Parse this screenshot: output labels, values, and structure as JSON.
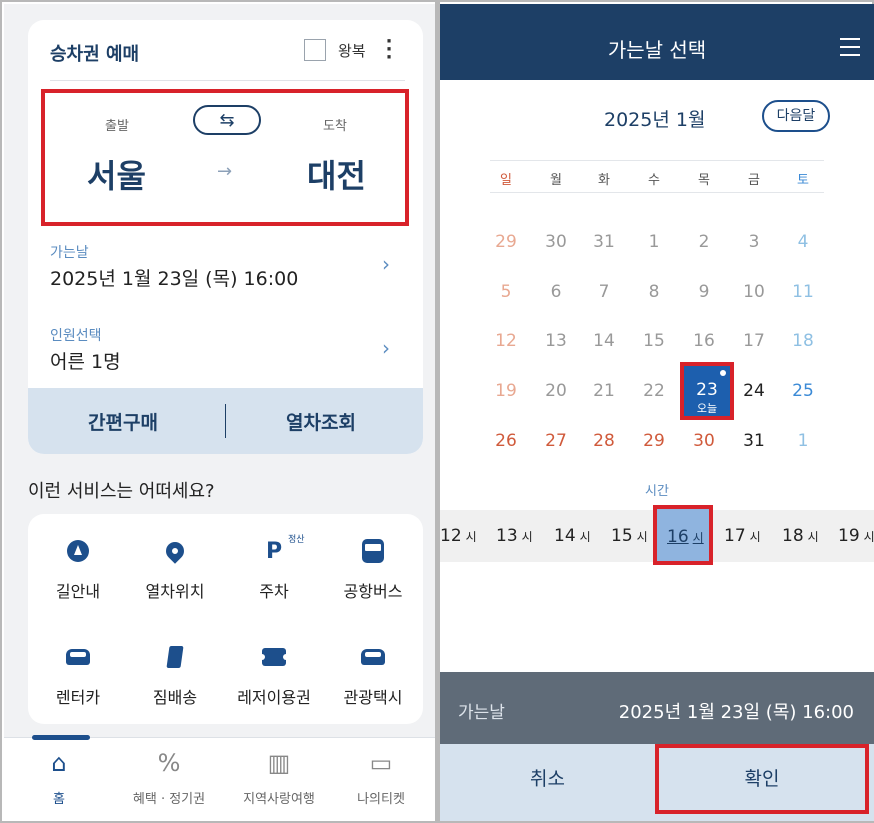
{
  "left": {
    "ticket_title": "승차권 예매",
    "roundtrip_label": "왕복",
    "departure_label": "출발",
    "arrival_label": "도착",
    "departure_city": "서울",
    "arrival_city": "대전",
    "date_label": "가는날",
    "date_value": "2025년 1월 23일 (목) 16:00",
    "people_label": "인원선택",
    "people_value": "어른 1명",
    "easy_buy": "간편구매",
    "train_search": "열차조회",
    "services_title": "이런 서비스는 어떠세요?",
    "services": [
      {
        "label": "길안내",
        "icon": "navigation-icon"
      },
      {
        "label": "열차위치",
        "icon": "location-pin-icon"
      },
      {
        "label": "주차",
        "icon": "parking-icon",
        "badge": "정산"
      },
      {
        "label": "공항버스",
        "icon": "bus-icon"
      },
      {
        "label": "렌터카",
        "icon": "car-icon"
      },
      {
        "label": "짐배송",
        "icon": "luggage-icon"
      },
      {
        "label": "레저이용권",
        "icon": "ticket-icon"
      },
      {
        "label": "관광택시",
        "icon": "taxi-icon"
      }
    ],
    "nav": [
      {
        "label": "홈",
        "icon": "home-icon"
      },
      {
        "label": "혜택 · 정기권",
        "icon": "discount-icon"
      },
      {
        "label": "지역사랑여행",
        "icon": "suitcase-icon"
      },
      {
        "label": "나의티켓",
        "icon": "my-ticket-icon"
      }
    ]
  },
  "right": {
    "header_title": "가는날 선택",
    "month_label": "2025년 1월",
    "next_month": "다음달",
    "weekdays": [
      "일",
      "월",
      "화",
      "수",
      "목",
      "금",
      "토"
    ],
    "weeks": [
      [
        "29",
        "30",
        "31",
        "1",
        "2",
        "3",
        "4"
      ],
      [
        "5",
        "6",
        "7",
        "8",
        "9",
        "10",
        "11"
      ],
      [
        "12",
        "13",
        "14",
        "15",
        "16",
        "17",
        "18"
      ],
      [
        "19",
        "20",
        "21",
        "22",
        "23",
        "24",
        "25"
      ],
      [
        "26",
        "27",
        "28",
        "29",
        "30",
        "31",
        "1"
      ]
    ],
    "today_sub": "오늘",
    "time_label": "시간",
    "hours": [
      "12",
      "13",
      "14",
      "15",
      "16",
      "17",
      "18",
      "19"
    ],
    "hour_unit": "시",
    "summary_label": "가는날",
    "summary_value": "2025년 1월 23일 (목) 16:00",
    "cancel": "취소",
    "confirm": "확인",
    "colors": {
      "navy": "#1d3f66",
      "holiday_red": "#d05a3b",
      "saturday_blue": "#3b8ad6",
      "highlight_red": "#d8222a"
    }
  }
}
